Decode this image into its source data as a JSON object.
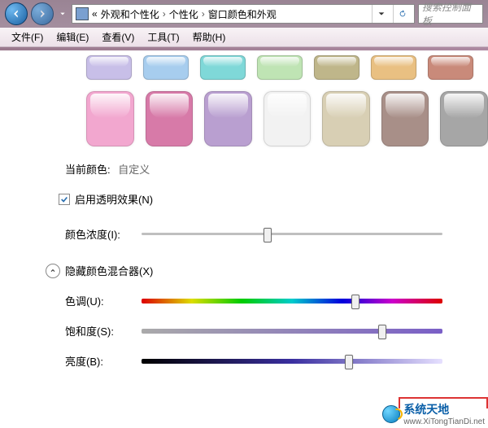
{
  "titlebar": {
    "crumb_prefix": "«",
    "crumb_sep": "›",
    "crumb1": "外观和个性化",
    "crumb2": "个性化",
    "crumb3": "窗口颜色和外观",
    "search_placeholder": "搜索控制面板"
  },
  "menu": {
    "file": "文件(F)",
    "edit": "编辑(E)",
    "view": "查看(V)",
    "tools": "工具(T)",
    "help": "帮助(H)"
  },
  "swatches_row1": [
    {
      "name": "color-lavender",
      "color": "#c8bfe8"
    },
    {
      "name": "color-lightblue",
      "color": "#a7cdee"
    },
    {
      "name": "color-teal",
      "color": "#7fd8d8"
    },
    {
      "name": "color-mint",
      "color": "#bfe4b4"
    },
    {
      "name": "color-olive",
      "color": "#bfb68a"
    },
    {
      "name": "color-orange",
      "color": "#e9c082"
    },
    {
      "name": "color-brick",
      "color": "#c98a7a"
    }
  ],
  "swatches_row2": [
    {
      "name": "color-pink",
      "color": "#f2a7cf"
    },
    {
      "name": "color-rose",
      "color": "#d77aa8"
    },
    {
      "name": "color-violet",
      "color": "#b99fd0"
    },
    {
      "name": "color-white",
      "color": "#f2f2f2"
    },
    {
      "name": "color-beige",
      "color": "#d8cfb4"
    },
    {
      "name": "color-taupe",
      "color": "#a88f88"
    },
    {
      "name": "color-gray",
      "color": "#a6a6a6"
    }
  ],
  "current_color": {
    "label": "当前颜色:",
    "value": "自定义"
  },
  "transparency": {
    "label": "启用透明效果(N)",
    "checked": true
  },
  "intensity": {
    "label": "颜色浓度(I):",
    "value_pct": 42
  },
  "mixer_toggle": {
    "label": "隐藏颜色混合器(X)"
  },
  "hue": {
    "label": "色调(U):",
    "value_pct": 71
  },
  "saturation": {
    "label": "饱和度(S):",
    "value_pct": 80
  },
  "brightness": {
    "label": "亮度(B):",
    "value_pct": 69
  },
  "watermark": {
    "cn": "系统天地",
    "url": "www.XiTongTianDi.net"
  }
}
